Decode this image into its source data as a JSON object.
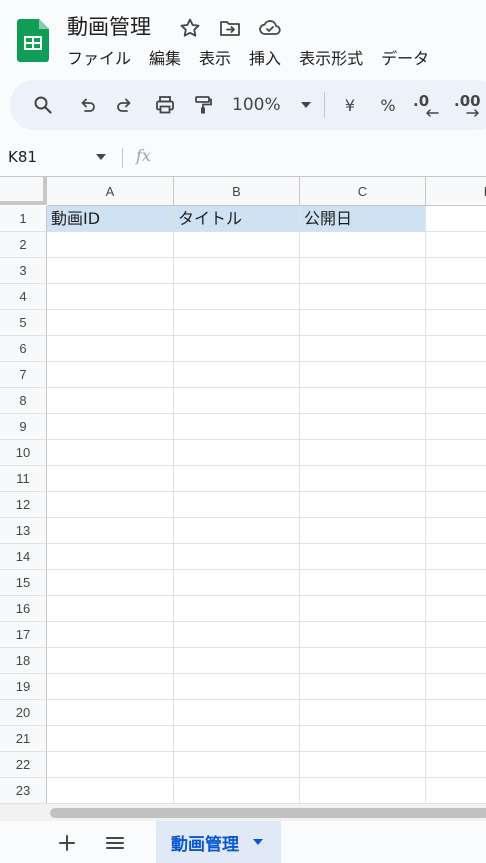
{
  "app": {
    "title": "動画管理",
    "brand_color": "#0f9d58"
  },
  "menu": [
    "ファイル",
    "編集",
    "表示",
    "挿入",
    "表示形式",
    "データ"
  ],
  "toolbar": {
    "zoom": "100%",
    "currency_symbol": "¥",
    "percent_symbol": "%",
    "decrease_decimal": ".0",
    "increase_decimal": ".00"
  },
  "formula_bar": {
    "name_box": "K81",
    "fx_label": "fx",
    "formula": ""
  },
  "grid": {
    "columns": [
      "A",
      "B",
      "C",
      "D"
    ],
    "rows": [
      "1",
      "2",
      "3",
      "4",
      "5",
      "6",
      "7",
      "8",
      "9",
      "10",
      "11",
      "12",
      "13",
      "14",
      "15",
      "16",
      "17",
      "18",
      "19",
      "20",
      "21",
      "22",
      "23"
    ],
    "cells": [
      [
        "動画ID",
        "タイトル",
        "公開日",
        ""
      ]
    ],
    "header_fill": "#cfe2f3"
  },
  "sheets": [
    {
      "name": "動画管理",
      "active": true
    }
  ]
}
